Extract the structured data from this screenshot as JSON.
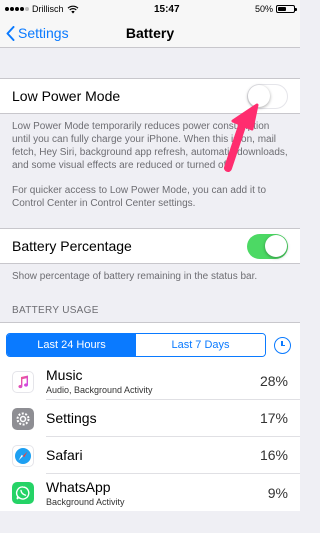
{
  "status_bar": {
    "carrier": "Drillisch",
    "time": "15:47",
    "battery_percent_label": "50%",
    "battery_level": 0.5
  },
  "nav": {
    "back_label": "Settings",
    "title": "Battery"
  },
  "low_power": {
    "label": "Low Power Mode",
    "enabled": false,
    "description": "Low Power Mode temporarily reduces power consumption until you can fully charge your iPhone. When this is on, mail fetch, Hey Siri, background app refresh, automatic downloads, and some visual effects are reduced or turned off.",
    "hint": "For quicker access to Low Power Mode, you can add it to Control Center in Control Center settings."
  },
  "battery_percentage": {
    "label": "Battery Percentage",
    "enabled": true,
    "description": "Show percentage of battery remaining in the status bar."
  },
  "usage": {
    "header": "BATTERY USAGE",
    "tabs": [
      {
        "label": "Last 24 Hours",
        "active": true
      },
      {
        "label": "Last 7 Days",
        "active": false
      }
    ],
    "apps": [
      {
        "name": "Music",
        "subtitle": "Audio, Background Activity",
        "percent": "28%",
        "icon": "music-icon"
      },
      {
        "name": "Settings",
        "subtitle": "",
        "percent": "17%",
        "icon": "settings-gear-icon"
      },
      {
        "name": "Safari",
        "subtitle": "",
        "percent": "16%",
        "icon": "safari-compass-icon"
      },
      {
        "name": "WhatsApp",
        "subtitle": "Background Activity",
        "percent": "9%",
        "icon": "whatsapp-icon"
      }
    ]
  },
  "colors": {
    "accent": "#0a7aff",
    "toggle_on": "#4cd964",
    "annotation_arrow": "#ff2d6f"
  }
}
